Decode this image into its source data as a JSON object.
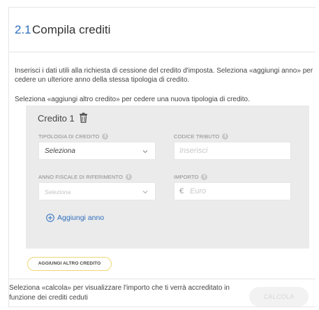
{
  "header": {
    "step_number": "2.1",
    "title": "Compila crediti"
  },
  "intro": {
    "line1": "Inserisci i dati utili alla richiesta di cessione del credito d'imposta. Seleziona «aggiungi anno» per cedere un ulteriore anno della stessa tipologia di credito.",
    "line2": "Seleziona «aggiungi altro credito» per cedere una nuova tipologia di credito."
  },
  "credit": {
    "title": "Credito 1",
    "fields": {
      "tipologia": {
        "label": "TIPOLOGIA DI CREDITO",
        "value": "Seleziona"
      },
      "codice_tributo": {
        "label": "CODICE TRIBUTO",
        "placeholder": "Inserisci"
      },
      "anno_fiscale": {
        "label": "ANNO FISCALE DI RIFERIMENTO",
        "placeholder": "Seleziona"
      },
      "importo": {
        "label": "IMPORTO",
        "currency": "€",
        "placeholder": "Euro"
      }
    },
    "add_year_label": "Aggiungi anno"
  },
  "add_credit_label": "AGGIUNGI ALTRO CREDITO",
  "footer": {
    "text": "Seleziona «calcola» per visualizzare l'importo che ti verrà accreditato in funzione dei crediti ceduti",
    "calc_label": "CALCOLA"
  },
  "colors": {
    "accent_blue": "#2f6fbd",
    "button_outline_yellow": "#f0d774",
    "panel_gray": "#ebebeb"
  },
  "icons": {
    "trash": "trash-icon",
    "info": "info-icon",
    "chevron": "chevron-down-icon",
    "add": "plus-circle-icon"
  }
}
